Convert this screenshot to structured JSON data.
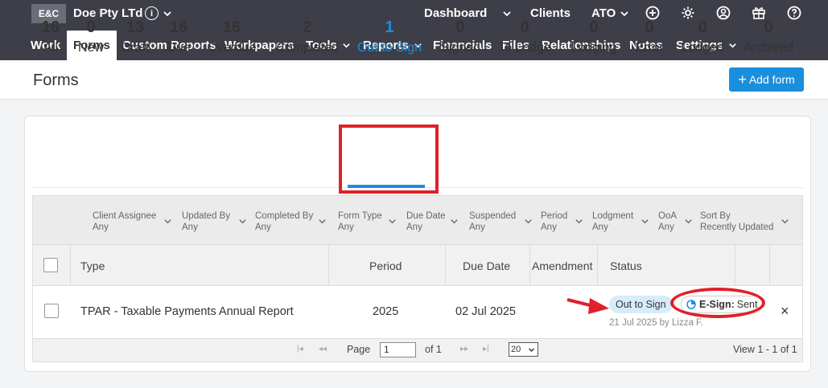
{
  "header": {
    "logo": "E&C",
    "company": "Doe Pty LTd",
    "info_glyph": "i",
    "links": {
      "dashboard": "Dashboard",
      "clients": "Clients",
      "ato": "ATO"
    }
  },
  "nav": {
    "items": [
      {
        "label": "Work"
      },
      {
        "label": "Forms"
      },
      {
        "label": "Custom Reports"
      },
      {
        "label": "Workpapers"
      },
      {
        "label": "Tools"
      },
      {
        "label": "Reports"
      },
      {
        "label": "Financials"
      },
      {
        "label": "Files"
      },
      {
        "label": "Relationships"
      },
      {
        "label": "Notes"
      },
      {
        "label": "Settings"
      }
    ]
  },
  "page": {
    "title": "Forms",
    "add_button": "Add form",
    "add_plus": "+"
  },
  "stats": [
    {
      "num": "16",
      "label": "All"
    },
    {
      "num": "0",
      "label": "New"
    },
    {
      "num": "13",
      "label": "Draft"
    },
    {
      "num": "16",
      "label": "Due"
    },
    {
      "num": "16",
      "label": "Overdue"
    },
    {
      "num": "2",
      "label": "Completed"
    },
    {
      "num": "1",
      "label": "Out to Sign"
    },
    {
      "num": "0",
      "label": "Signed"
    },
    {
      "num": "0",
      "label": "To Lodge"
    },
    {
      "num": "0",
      "label": "Lodging"
    },
    {
      "num": "0",
      "label": "Error"
    },
    {
      "num": "0",
      "label": "Lodged"
    },
    {
      "num": "0",
      "label": "Archived"
    }
  ],
  "filters": [
    {
      "label": "Client Assignee",
      "value": "Any"
    },
    {
      "label": "Updated By",
      "value": "Any"
    },
    {
      "label": "Completed By",
      "value": "Any"
    },
    {
      "label": "Form Type",
      "value": "Any"
    },
    {
      "label": "Due Date",
      "value": "Any"
    },
    {
      "label": "Suspended",
      "value": "Any"
    },
    {
      "label": "Period",
      "value": "Any"
    },
    {
      "label": "Lodgment",
      "value": "Any"
    },
    {
      "label": "OoA",
      "value": "Any"
    },
    {
      "label": "Sort By",
      "value": "Recently Updated"
    }
  ],
  "columns": {
    "type": "Type",
    "period": "Period",
    "due_date": "Due Date",
    "amendment": "Amendment",
    "status": "Status"
  },
  "row": {
    "type": "TPAR - Taxable Payments Annual Report",
    "period": "2025",
    "due_date": "02 Jul 2025",
    "status_pill": "Out to Sign",
    "esign_label": "E-Sign:",
    "esign_value": "Sent",
    "status_sub": "21 Jul 2025 by Lizza F.",
    "close": "×"
  },
  "pager": {
    "page_label": "Page",
    "page_value": "1",
    "of_label": "of 1",
    "per_page": "20",
    "view": "View 1 - 1 of 1",
    "first": "|◂",
    "prev": "◂◂",
    "next": "▸▸",
    "last": "▸|"
  },
  "colors": {
    "accent": "#1a8fde",
    "annotation": "#e0202a",
    "header_bg": "#3d3e48"
  }
}
